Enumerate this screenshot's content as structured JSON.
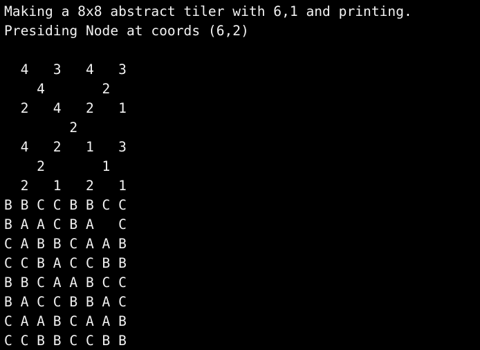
{
  "terminal": {
    "lines": [
      "Making a 8x8 abstract tiler with 6,1 and printing.",
      "Presiding Node at coords (6,2)",
      "",
      "  4   3   4   3",
      "    4       2",
      "  2   4   2   1",
      "        2",
      "  4   2   1   3",
      "    2       1",
      "  2   1   2   1",
      "B B C C B B C C",
      "B A A C B A   C",
      "C A B B C A A B",
      "C C B A C C B B",
      "B B C A A B C C",
      "B A C C B B A C",
      "C A A B C A A B",
      "C C B B C C B B"
    ]
  }
}
